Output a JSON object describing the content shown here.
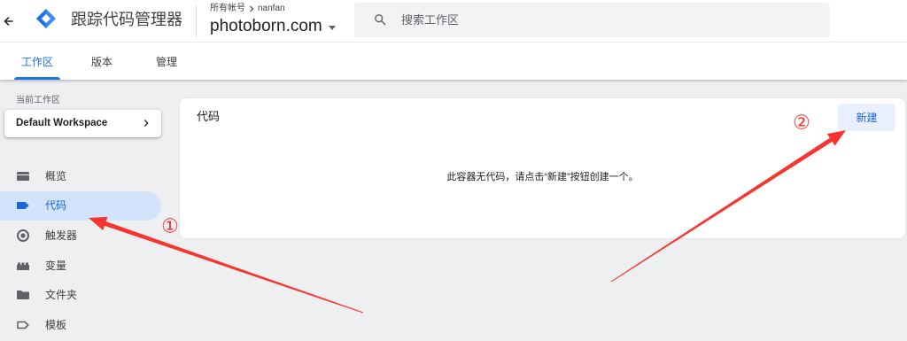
{
  "app": {
    "title": "跟踪代码管理器",
    "logo_icon": "gtm-logo-icon"
  },
  "header": {
    "back_icon": "arrow-back-icon",
    "breadcrumb": {
      "root": "所有帐号",
      "separator_icon": "chevron-right-icon",
      "account": "nanfan"
    },
    "container": {
      "name": "photoborn.com",
      "dropdown_icon": "caret-down-icon"
    },
    "search": {
      "icon": "search-icon",
      "placeholder": "搜索工作区",
      "value": ""
    }
  },
  "tabs": [
    {
      "label": "工作区",
      "active": true
    },
    {
      "label": "版本",
      "active": false
    },
    {
      "label": "管理",
      "active": false
    }
  ],
  "sidebar": {
    "workspace_label": "当前工作区",
    "workspace": {
      "name": "Default Workspace",
      "icon": "chevron-right-icon"
    },
    "items": [
      {
        "label": "概览",
        "icon": "overview-icon",
        "active": false
      },
      {
        "label": "代码",
        "icon": "tag-icon",
        "active": true
      },
      {
        "label": "触发器",
        "icon": "trigger-icon",
        "active": false
      },
      {
        "label": "变量",
        "icon": "variable-icon",
        "active": false
      },
      {
        "label": "文件夹",
        "icon": "folder-icon",
        "active": false
      },
      {
        "label": "模板",
        "icon": "template-icon",
        "active": false
      }
    ]
  },
  "main": {
    "title": "代码",
    "new_button_label": "新建",
    "empty_message": "此容器无代码，请点击“新建”按钮创建一个。"
  },
  "annotations": [
    {
      "label": "①"
    },
    {
      "label": "②"
    }
  ],
  "colors": {
    "accent": "#1a73e8",
    "accent_text": "#1967d2",
    "selected_bg": "#d2e3fc",
    "button_bg": "#e8f0fe",
    "annotation": "#f5352e"
  }
}
